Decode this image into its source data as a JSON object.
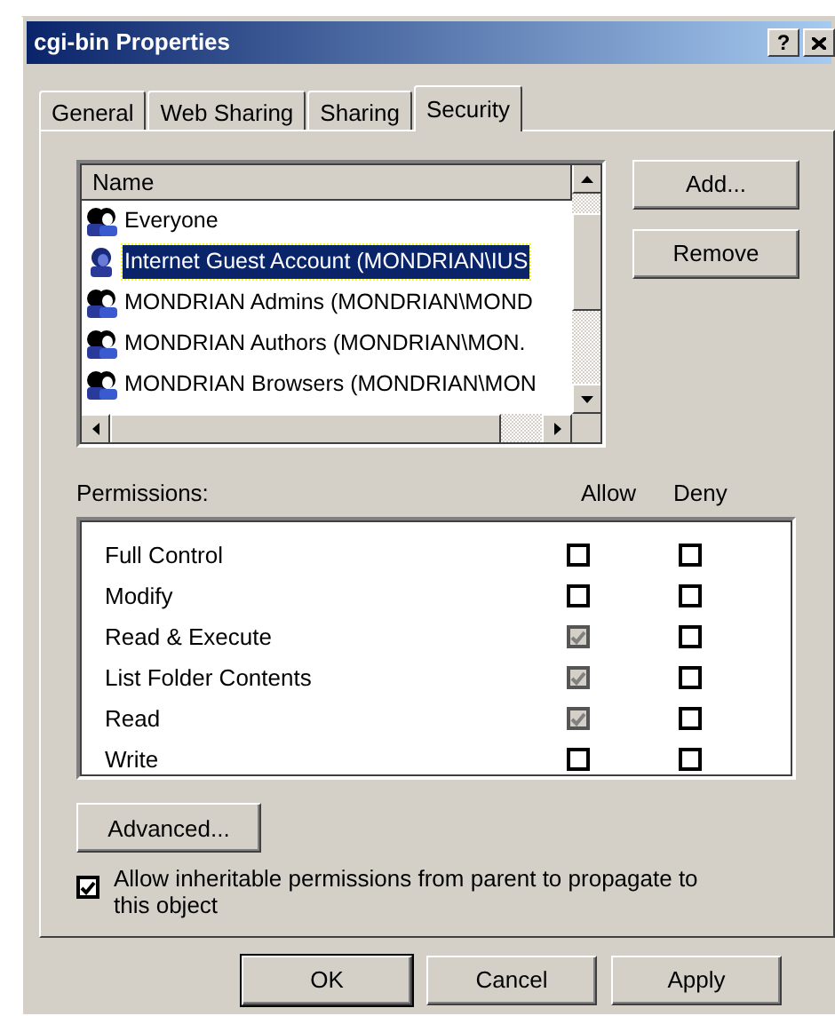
{
  "window": {
    "title": "cgi-bin Properties",
    "help_button": "?"
  },
  "tabs": [
    {
      "label": "General",
      "selected": false
    },
    {
      "label": "Web Sharing",
      "selected": false
    },
    {
      "label": "Sharing",
      "selected": false
    },
    {
      "label": "Security",
      "selected": true
    }
  ],
  "names_list": {
    "header": "Name",
    "items": [
      {
        "kind": "group",
        "label": "Everyone",
        "selected": false
      },
      {
        "kind": "user",
        "label": "Internet Guest Account (MONDRIAN\\IUS",
        "selected": true
      },
      {
        "kind": "group",
        "label": "MONDRIAN Admins (MONDRIAN\\MOND",
        "selected": false
      },
      {
        "kind": "group",
        "label": "MONDRIAN Authors (MONDRIAN\\MON.",
        "selected": false
      },
      {
        "kind": "group",
        "label": "MONDRIAN Browsers (MONDRIAN\\MON",
        "selected": false
      }
    ]
  },
  "side_buttons": [
    "Add...",
    "Remove"
  ],
  "permissions": {
    "label": "Permissions:",
    "allow_header": "Allow",
    "deny_header": "Deny",
    "rows": [
      {
        "label": "Full Control",
        "allow": {
          "checked": false,
          "disabled": false
        },
        "deny": {
          "checked": false,
          "disabled": false
        }
      },
      {
        "label": "Modify",
        "allow": {
          "checked": false,
          "disabled": false
        },
        "deny": {
          "checked": false,
          "disabled": false
        }
      },
      {
        "label": "Read & Execute",
        "allow": {
          "checked": true,
          "disabled": true
        },
        "deny": {
          "checked": false,
          "disabled": false
        }
      },
      {
        "label": "List Folder Contents",
        "allow": {
          "checked": true,
          "disabled": true
        },
        "deny": {
          "checked": false,
          "disabled": false
        }
      },
      {
        "label": "Read",
        "allow": {
          "checked": true,
          "disabled": true
        },
        "deny": {
          "checked": false,
          "disabled": false
        }
      },
      {
        "label": "Write",
        "allow": {
          "checked": false,
          "disabled": false
        },
        "deny": {
          "checked": false,
          "disabled": false
        }
      }
    ]
  },
  "advanced_button": "Advanced...",
  "inherit": {
    "label": "Allow inheritable permissions from parent to propagate to this object",
    "checked": true
  },
  "footer_buttons": [
    "OK",
    "Cancel",
    "Apply"
  ]
}
